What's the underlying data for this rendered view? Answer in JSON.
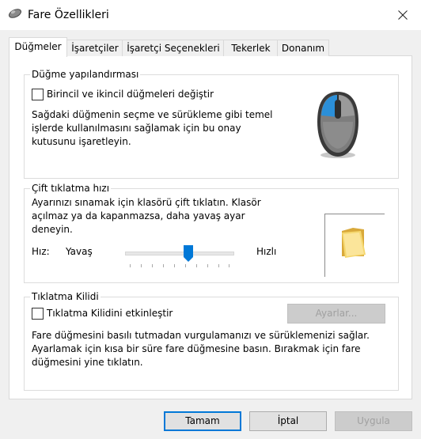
{
  "window": {
    "title": "Fare Özellikleri"
  },
  "tabs": [
    {
      "label": "Düğmeler",
      "active": true
    },
    {
      "label": "İşaretçiler"
    },
    {
      "label": "İşaretçi Seçenekleri"
    },
    {
      "label": "Tekerlek"
    },
    {
      "label": "Donanım"
    }
  ],
  "button_config": {
    "title": "Düğme yapılandırması",
    "checkbox_label": "Birincil ve ikincil düğmeleri değiştir",
    "checked": false,
    "description": [
      "Sağdaki düğmenin seçme ve sürükleme gibi temel",
      "işlerde kullanılmasını sağlamak için bu onay",
      "kutusunu işaretleyin."
    ]
  },
  "double_click": {
    "title": "Çift tıklatma hızı",
    "description": [
      "Ayarınızı sınamak için klasörü çift tıklatın. Klasör",
      "açılmaz ya da kapanmazsa, daha yavaş ayar",
      "deneyin."
    ],
    "speed_label": "Hız:",
    "slow_label": "Yavaş",
    "fast_label": "Hızlı",
    "speed_value": 0.58
  },
  "click_lock": {
    "title": "Tıklatma Kilidi",
    "checkbox_label": "Tıklatma Kilidini etkinleştir",
    "checked": false,
    "settings_label": "Ayarlar...",
    "description": [
      "Fare düğmesini basılı tutmadan vurgulamanızı ve sürüklemenizi sağlar.",
      "Ayarlamak için kısa bir süre fare düğmesine basın.  Bırakmak için fare",
      "düğmesini yine tıklatın."
    ]
  },
  "footer": {
    "ok_label": "Tamam",
    "cancel_label": "İptal",
    "apply_label": "Uygula"
  },
  "colors": {
    "accent": "#0078d7",
    "mouse_highlight": "#2b8fd8"
  }
}
